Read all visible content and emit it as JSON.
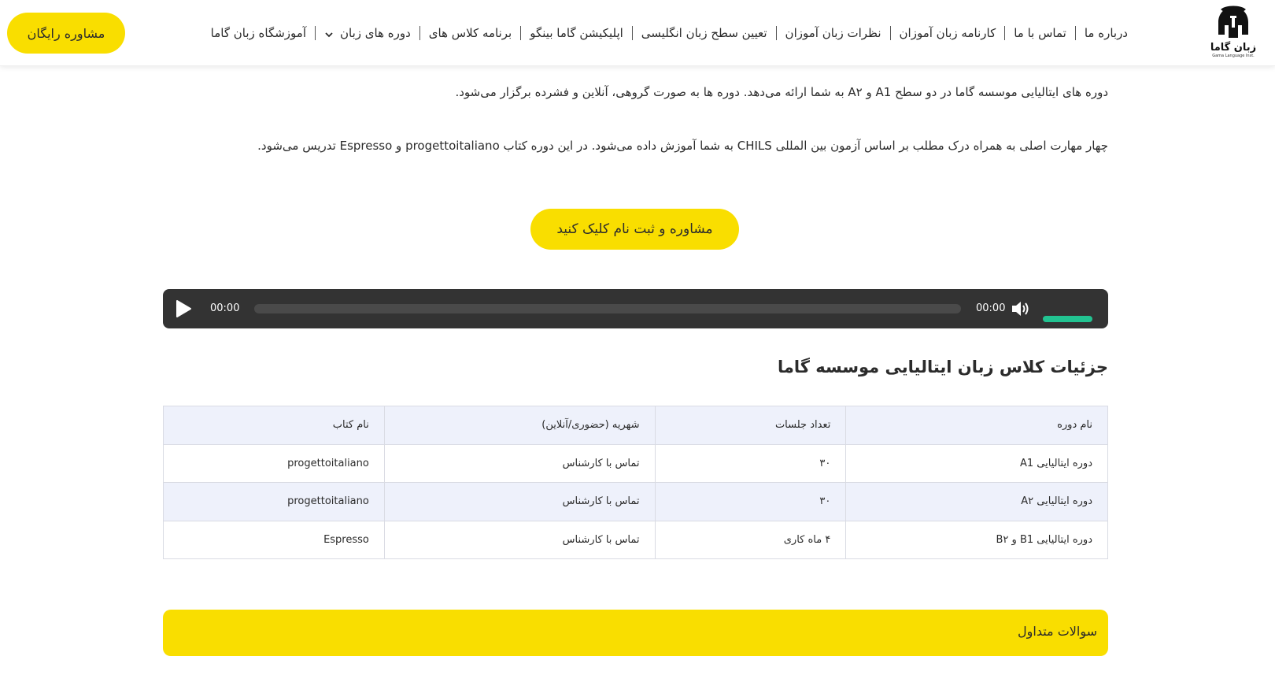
{
  "header": {
    "cta_label": "مشاوره رایگان",
    "nav": [
      {
        "label": "آموزشگاه زبان گاما",
        "has_dropdown": false
      },
      {
        "label": "دوره های زبان",
        "has_dropdown": true
      },
      {
        "label": "برنامه کلاس های",
        "has_dropdown": false
      },
      {
        "label": "اپلیکیشن گاما بینگو",
        "has_dropdown": false
      },
      {
        "label": "تعیین سطح زبان انگلیسی",
        "has_dropdown": false
      },
      {
        "label": "نظرات زبان آموزان",
        "has_dropdown": false
      },
      {
        "label": "کارنامه زبان آموزان",
        "has_dropdown": false
      },
      {
        "label": "تماس با ما",
        "has_dropdown": false
      },
      {
        "label": "درباره ما",
        "has_dropdown": false
      }
    ],
    "logo": {
      "name": "زبان گاما",
      "tagline": "Gama Language Inst.",
      "icon": "spartan-helmet-icon"
    }
  },
  "content": {
    "paragraph1": "دوره های ایتالیایی موسسه گاما در دو سطح A1 و A۲ به شما ارائه می‌دهد. دوره ها به صورت گروهی، آنلاین و فشرده برگزار می‌شود.",
    "paragraph2": "چهار مهارت اصلی به همراه درک مطلب بر اساس آزمون بین المللی CHILS به شما آموزش داده می‌شود. در این  دوره کتاب progettoitaliano و Espresso تدریس می‌شود.",
    "cta_label": "مشاوره و ثبت نام کلیک کنید"
  },
  "audio_player": {
    "current_time": "00:00",
    "duration": "00:00",
    "progress": 0,
    "volume": 1.0,
    "accent_color": "#22c391"
  },
  "details": {
    "title": "جزئیات کلاس زبان ایتالیایی موسسه گاما",
    "table": {
      "headers": [
        "نام دوره",
        "تعداد جلسات",
        "شهریه (حضوری/آنلاین)",
        "نام کتاب"
      ],
      "rows": [
        [
          "دوره ایتالیایی A1",
          "۳۰",
          "تماس با کارشناس",
          "progettoitaliano"
        ],
        [
          "دوره ایتالیایی A۲",
          "۳۰",
          "تماس با کارشناس",
          "progettoitaliano"
        ],
        [
          "دوره ایتالیایی B1 و B۲",
          "۴ ماه کاری",
          "تماس با کارشناس",
          "Espresso"
        ]
      ]
    }
  },
  "faq": {
    "label": "سوالات متداول"
  },
  "colors": {
    "brand_yellow": "#f9de00",
    "player_bg": "#333333",
    "table_stripe": "#eef1fb"
  }
}
